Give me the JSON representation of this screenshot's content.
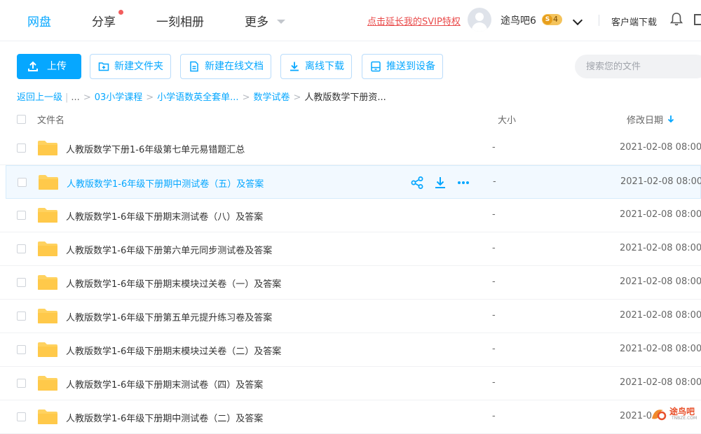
{
  "nav": {
    "items": [
      {
        "label": "网盘"
      },
      {
        "label": "分享"
      },
      {
        "label": "一刻相册"
      },
      {
        "label": "更多"
      }
    ],
    "svip_link": "点击延长我的SVIP特权",
    "username": "途鸟吧6",
    "vip_level": "4",
    "client_download": "客户端下载"
  },
  "toolbar": {
    "upload": "上传",
    "new_folder": "新建文件夹",
    "new_doc": "新建在线文档",
    "offline_download": "离线下载",
    "push_device": "推送到设备",
    "search_placeholder": "搜索您的文件"
  },
  "breadcrumb": {
    "back": "返回上一级",
    "ellipsis": "...",
    "items": [
      "03小学课程",
      "小学语数英全套单...",
      "数学试卷"
    ],
    "current": "人教版数学下册资..."
  },
  "table": {
    "headers": {
      "name": "文件名",
      "size": "大小",
      "date": "修改日期"
    },
    "rows": [
      {
        "name": "人教版数学下册1-6年级第七单元易错题汇总",
        "size": "-",
        "date": "2021-02-08 08:00"
      },
      {
        "name": "人教版数学1-6年级下册期中测试卷（五）及答案",
        "size": "-",
        "date": "2021-02-08 08:00"
      },
      {
        "name": "人教版数学1-6年级下册期末测试卷（八）及答案",
        "size": "-",
        "date": "2021-02-08 08:00"
      },
      {
        "name": "人教版数学1-6年级下册第六单元同步测试卷及答案",
        "size": "-",
        "date": "2021-02-08 08:00"
      },
      {
        "name": "人教版数学1-6年级下册期末模块过关卷（一）及答案",
        "size": "-",
        "date": "2021-02-08 08:00"
      },
      {
        "name": "人教版数学1-6年级下册第五单元提升练习卷及答案",
        "size": "-",
        "date": "2021-02-08 08:00"
      },
      {
        "name": "人教版数学1-6年级下册期末模块过关卷（二）及答案",
        "size": "-",
        "date": "2021-02-08 08:00"
      },
      {
        "name": "人教版数学1-6年级下册期末测试卷（四）及答案",
        "size": "-",
        "date": "2021-02-08 08:00"
      },
      {
        "name": "人教版数学1-6年级下册期中测试卷（二）及答案",
        "size": "-",
        "date": "2021-0"
      }
    ]
  },
  "watermark": {
    "text": "途鸟吧",
    "sub": "TNBZE.COM"
  },
  "colors": {
    "accent": "#06a7ff",
    "folder": "#ffd25f",
    "svip": "#e94a4a"
  },
  "icons": {
    "share": "share-icon",
    "download": "download-icon",
    "more": "more-icon",
    "bell": "bell-icon",
    "folder": "folder-icon"
  }
}
